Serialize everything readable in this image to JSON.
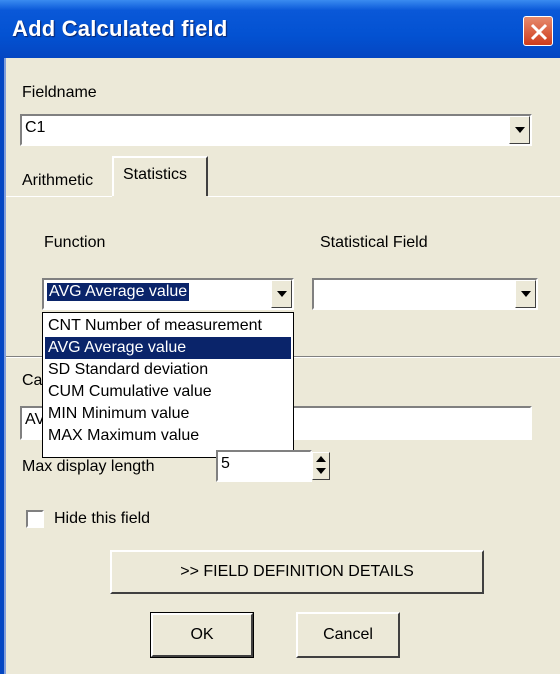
{
  "window": {
    "title": "Add Calculated field"
  },
  "fieldname": {
    "label": "Fieldname",
    "value": "C1"
  },
  "tabs": [
    {
      "label": "Arithmetic"
    },
    {
      "label": "Statistics"
    }
  ],
  "statistics": {
    "function_label": "Function",
    "function_value": "AVG Average value",
    "stat_field_label": "Statistical Field",
    "stat_field_value": "",
    "options": [
      {
        "label": "CNT Number of measurement",
        "selected": false
      },
      {
        "label": "AVG Average value",
        "selected": true
      },
      {
        "label": "SD Standard deviation",
        "selected": false
      },
      {
        "label": "CUM Cumulative value",
        "selected": false
      },
      {
        "label": "MIN Minimum value",
        "selected": false
      },
      {
        "label": "MAX Maximum value",
        "selected": false
      }
    ]
  },
  "calc": {
    "label_partial": "Ca",
    "value_partial": "AV"
  },
  "max_display": {
    "label": "Max display length",
    "value": "5"
  },
  "hide_field": {
    "label": "Hide this field",
    "checked": false
  },
  "buttons": {
    "details": ">> FIELD DEFINITION DETAILS",
    "ok": "OK",
    "cancel": "Cancel"
  },
  "colors": {
    "title_bar": "#0352d2",
    "selection": "#0a246a",
    "dialog_bg": "#ece9d8"
  }
}
